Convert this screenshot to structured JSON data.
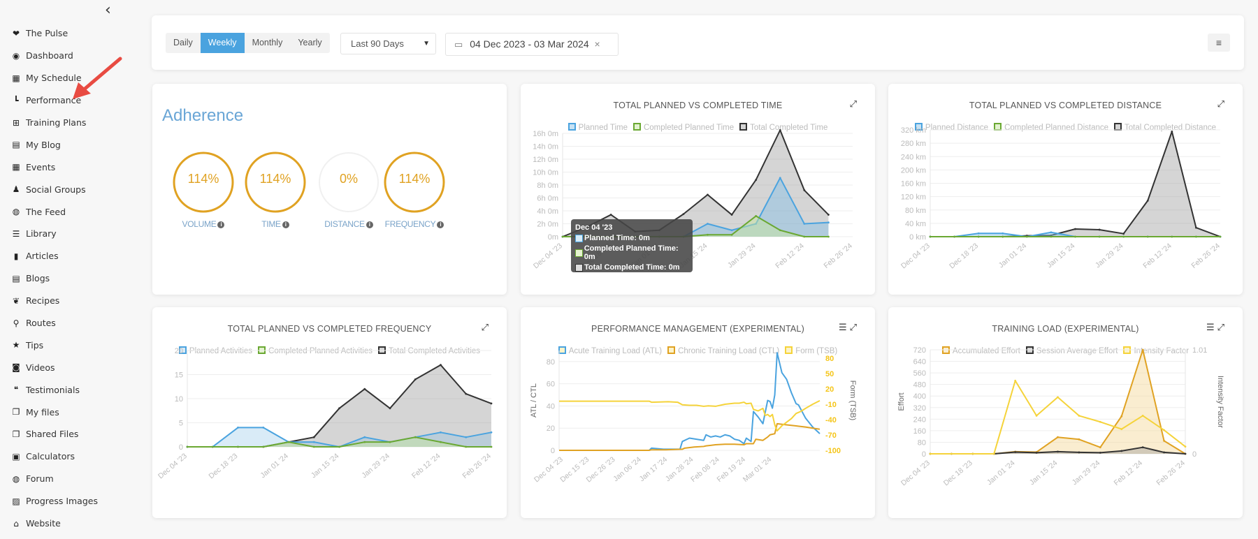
{
  "sidebar": {
    "collapse_icon": "chevron-left",
    "items": [
      {
        "label": "The Pulse",
        "icon": "heartbeat-icon",
        "glyph": "❤"
      },
      {
        "label": "Dashboard",
        "icon": "tachometer-icon",
        "glyph": "◉"
      },
      {
        "label": "My Schedule",
        "icon": "calendar-icon",
        "glyph": "▦"
      },
      {
        "label": "Performance",
        "icon": "bar-chart-icon",
        "glyph": "┗"
      },
      {
        "label": "Training Plans",
        "icon": "grid-icon",
        "glyph": "⊞"
      },
      {
        "label": "My Blog",
        "icon": "newspaper-icon",
        "glyph": "▤"
      },
      {
        "label": "Events",
        "icon": "calendar-icon",
        "glyph": "▦"
      },
      {
        "label": "Social Groups",
        "icon": "users-icon",
        "glyph": "♟"
      },
      {
        "label": "The Feed",
        "icon": "comments-icon",
        "glyph": "◍"
      },
      {
        "label": "Library",
        "icon": "list-icon",
        "glyph": "☰"
      },
      {
        "label": "Articles",
        "icon": "file-icon",
        "glyph": "▮"
      },
      {
        "label": "Blogs",
        "icon": "newspaper-icon",
        "glyph": "▤"
      },
      {
        "label": "Recipes",
        "icon": "leaf-icon",
        "glyph": "❦"
      },
      {
        "label": "Routes",
        "icon": "binoculars-icon",
        "glyph": "⚲"
      },
      {
        "label": "Tips",
        "icon": "star-icon",
        "glyph": "★"
      },
      {
        "label": "Videos",
        "icon": "camera-icon",
        "glyph": "◙"
      },
      {
        "label": "Testimonials",
        "icon": "quote-icon",
        "glyph": "❝"
      },
      {
        "label": "My files",
        "icon": "copy-icon",
        "glyph": "❐"
      },
      {
        "label": "Shared Files",
        "icon": "copy-icon",
        "glyph": "❐"
      },
      {
        "label": "Calculators",
        "icon": "calculator-icon",
        "glyph": "▣"
      },
      {
        "label": "Forum",
        "icon": "comments-icon",
        "glyph": "◍"
      },
      {
        "label": "Progress Images",
        "icon": "image-icon",
        "glyph": "▨"
      },
      {
        "label": "Website",
        "icon": "home-icon",
        "glyph": "⌂"
      }
    ]
  },
  "toolbar": {
    "periods": [
      "Daily",
      "Weekly",
      "Monthly",
      "Yearly"
    ],
    "active_period": "Weekly",
    "range_select": "Last 90 Days",
    "date_range": "04 Dec 2023 - 03 Mar 2024",
    "clear_icon": "×",
    "menu_icon": "≡"
  },
  "adherence": {
    "title": "Adherence",
    "gauges": [
      {
        "label": "VOLUME",
        "value": "114%",
        "percent": 114
      },
      {
        "label": "TIME",
        "value": "114%",
        "percent": 114
      },
      {
        "label": "DISTANCE",
        "value": "0%",
        "percent": 0
      },
      {
        "label": "FREQUENCY",
        "value": "114%",
        "percent": 114
      }
    ]
  },
  "colors": {
    "accent": "#4aa3df",
    "gauge": "#e0a222",
    "planned": "#4aa3df",
    "completed_planned": "#6aa832",
    "total": "#333333",
    "ctl": "#e0a222",
    "tsb": "#f5d33a"
  },
  "chart_data": [
    {
      "id": "time",
      "type": "area",
      "title": "TOTAL PLANNED VS COMPLETED TIME",
      "x": [
        "Dec 04 '23",
        "Dec 11 '23",
        "Dec 18 '23",
        "Dec 25 '23",
        "Jan 01 '24",
        "Jan 08 '24",
        "Jan 15 '24",
        "Jan 22 '24",
        "Jan 29 '24",
        "Feb 05 '24",
        "Feb 12 '24",
        "Feb 19 '24",
        "Feb 26 '24"
      ],
      "xticks": [
        "Dec 04 '23",
        "Dec 18 '23",
        "Jan 01 '24",
        "Jan 15 '24",
        "Jan 29 '24",
        "Feb 12 '24",
        "Feb 26 '24"
      ],
      "ylabel": "",
      "ylim": [
        0,
        16
      ],
      "yticks": [
        0,
        2,
        4,
        6,
        8,
        10,
        12,
        14,
        16
      ],
      "ytick_labels": [
        "0m",
        "2h 0m",
        "4h 0m",
        "6h 0m",
        "8h 0m",
        "10h 0m",
        "12h 0m",
        "14h 0m",
        "16h 0m"
      ],
      "series": [
        {
          "name": "Total Completed Time",
          "color": "#333333",
          "fill": "rgba(150,150,150,0.4)",
          "values": [
            0,
            1.5,
            3.4,
            0.8,
            1.0,
            3.5,
            6.5,
            3.4,
            8.8,
            16.5,
            7.2,
            3.4
          ]
        },
        {
          "name": "Planned Time",
          "color": "#4aa3df",
          "fill": "rgba(130,190,230,0.45)",
          "values": [
            0,
            0,
            0,
            0,
            0,
            0,
            2.0,
            1.0,
            2.0,
            9.1,
            2.0,
            2.2
          ]
        },
        {
          "name": "Completed Planned Time",
          "color": "#6aa832",
          "fill": "rgba(200,230,160,0.5)",
          "values": [
            0,
            0,
            0,
            0,
            0,
            0,
            0.3,
            0.3,
            3.2,
            1.0,
            0,
            0
          ]
        }
      ],
      "legend": [
        "Planned Time",
        "Completed Planned Time",
        "Total Completed Time"
      ],
      "tooltip": {
        "title": "Dec 04 '23",
        "rows": [
          "Planned Time: 0m",
          "Completed Planned Time: 0m",
          "Total Completed Time: 0m"
        ]
      }
    },
    {
      "id": "distance",
      "type": "area",
      "title": "TOTAL PLANNED VS COMPLETED DISTANCE",
      "x": [
        "Dec 04 '23",
        "Dec 11 '23",
        "Dec 18 '23",
        "Dec 25 '23",
        "Jan 01 '24",
        "Jan 08 '24",
        "Jan 15 '24",
        "Jan 22 '24",
        "Jan 29 '24",
        "Feb 05 '24",
        "Feb 12 '24",
        "Feb 19 '24",
        "Feb 26 '24"
      ],
      "xticks": [
        "Dec 04 '23",
        "Dec 18 '23",
        "Jan 01 '24",
        "Jan 15 '24",
        "Jan 29 '24",
        "Feb 12 '24",
        "Feb 26 '24"
      ],
      "ylim": [
        0,
        320
      ],
      "yticks": [
        0,
        40,
        80,
        120,
        160,
        200,
        240,
        280,
        320
      ],
      "ytick_labels": [
        "0 km",
        "40 km",
        "80 km",
        "120 km",
        "160 km",
        "200 km",
        "240 km",
        "280 km",
        "320 km"
      ],
      "series": [
        {
          "name": "Total Completed Distance",
          "color": "#333333",
          "fill": "rgba(150,150,150,0.4)",
          "values": [
            0,
            0,
            0,
            0,
            3,
            4,
            23,
            21,
            9,
            108,
            315,
            27,
            0
          ]
        },
        {
          "name": "Planned Distance",
          "color": "#4aa3df",
          "fill": "rgba(130,190,230,0.45)",
          "values": [
            0,
            0,
            10,
            10,
            0,
            13,
            0,
            0,
            0,
            0,
            0,
            0,
            0
          ]
        },
        {
          "name": "Completed Planned Distance",
          "color": "#6aa832",
          "fill": "rgba(200,230,160,0.5)",
          "values": [
            0,
            0,
            0,
            0,
            0,
            0,
            0,
            0,
            0,
            0,
            0,
            0,
            0
          ]
        }
      ],
      "legend": [
        "Planned Distance",
        "Completed Planned Distance",
        "Total Completed Distance"
      ]
    },
    {
      "id": "frequency",
      "type": "area",
      "title": "TOTAL PLANNED VS COMPLETED FREQUENCY",
      "x": [
        "Dec 04 '23",
        "Dec 11 '23",
        "Dec 18 '23",
        "Dec 25 '23",
        "Jan 01 '24",
        "Jan 08 '24",
        "Jan 15 '24",
        "Jan 22 '24",
        "Jan 29 '24",
        "Feb 05 '24",
        "Feb 12 '24",
        "Feb 19 '24",
        "Feb 26 '24"
      ],
      "xticks": [
        "Dec 04 '23",
        "Dec 18 '23",
        "Jan 01 '24",
        "Jan 15 '24",
        "Jan 29 '24",
        "Feb 12 '24",
        "Feb 26 '24"
      ],
      "ylim": [
        0,
        20
      ],
      "yticks": [
        0,
        5,
        10,
        15,
        20
      ],
      "ytick_labels": [
        "0",
        "5",
        "10",
        "15",
        "20"
      ],
      "series": [
        {
          "name": "Total Completed Activities",
          "color": "#333333",
          "fill": "rgba(150,150,150,0.4)",
          "values": [
            0,
            0,
            0,
            0,
            1,
            2,
            8,
            12,
            8,
            14,
            17,
            11,
            9
          ]
        },
        {
          "name": "Planned Activities",
          "color": "#4aa3df",
          "fill": "rgba(130,190,230,0.3)",
          "values": [
            0,
            0,
            4,
            4,
            1,
            1,
            0,
            2,
            1,
            2,
            3,
            2,
            3
          ]
        },
        {
          "name": "Completed Planned Activities",
          "color": "#6aa832",
          "fill": "rgba(200,230,160,0.5)",
          "values": [
            0,
            0,
            0,
            0,
            1,
            0,
            0,
            1,
            1,
            2,
            1,
            0,
            0
          ]
        }
      ],
      "legend": [
        "Planned Activities",
        "Completed Planned Activities",
        "Total Completed Activities"
      ]
    },
    {
      "id": "pmc",
      "type": "line",
      "title": "PERFORMANCE MANAGEMENT (EXPERIMENTAL)",
      "xticks": [
        "Dec 04 '23",
        "Dec 15 '23",
        "Dec 26 '23",
        "Jan 06 '24",
        "Jan 17 '24",
        "Jan 28 '24",
        "Feb 08 '24",
        "Feb 19 '24",
        "Mar 01 '24"
      ],
      "x_days": 91,
      "ylabel": "ATL / CTL",
      "y2label": "Form (TSB)",
      "ylim": [
        0,
        90
      ],
      "yticks": [
        0,
        20,
        40,
        60,
        80
      ],
      "y2lim": [
        -100,
        95
      ],
      "y2ticks": [
        -100,
        -70,
        -40,
        -10,
        20,
        50,
        80
      ],
      "series": [
        {
          "name": "Acute Training Load (ATL)",
          "color": "#4aa3df",
          "axis": "left",
          "points": [
            [
              0,
              0
            ],
            [
              38,
              0
            ],
            [
              39,
              2
            ],
            [
              44,
              1
            ],
            [
              51,
              1
            ],
            [
              52,
              8
            ],
            [
              55,
              11
            ],
            [
              58,
              10
            ],
            [
              61,
              9
            ],
            [
              62,
              14
            ],
            [
              64,
              12
            ],
            [
              66,
              13
            ],
            [
              68,
              12
            ],
            [
              70,
              14
            ],
            [
              72,
              13
            ],
            [
              74,
              10
            ],
            [
              76,
              9
            ],
            [
              78,
              6
            ],
            [
              79,
              11
            ],
            [
              81,
              8
            ],
            [
              82,
              35
            ],
            [
              84,
              30
            ],
            [
              86,
              24
            ],
            [
              88,
              45
            ],
            [
              89,
              44
            ],
            [
              90,
              38
            ],
            [
              91,
              50
            ],
            [
              92,
              88
            ],
            [
              94,
              70
            ],
            [
              96,
              64
            ],
            [
              98,
              52
            ],
            [
              100,
              42
            ],
            [
              101,
              41
            ],
            [
              104,
              29
            ],
            [
              107,
              21
            ],
            [
              110,
              15
            ]
          ]
        },
        {
          "name": "Chronic Training Load (CTL)",
          "color": "#e0a222",
          "axis": "left",
          "points": [
            [
              0,
              0
            ],
            [
              38,
              0
            ],
            [
              39,
              0.5
            ],
            [
              45,
              0.5
            ],
            [
              52,
              1
            ],
            [
              53,
              2
            ],
            [
              57,
              3
            ],
            [
              61,
              3.5
            ],
            [
              62,
              4
            ],
            [
              66,
              5
            ],
            [
              70,
              5.5
            ],
            [
              74,
              5.5
            ],
            [
              78,
              5
            ],
            [
              79,
              6
            ],
            [
              82,
              6
            ],
            [
              83,
              10
            ],
            [
              86,
              9
            ],
            [
              88,
              12
            ],
            [
              89,
              14
            ],
            [
              91,
              15
            ],
            [
              92,
              24
            ],
            [
              96,
              23
            ],
            [
              100,
              22
            ],
            [
              104,
              21
            ],
            [
              107,
              20
            ],
            [
              110,
              19
            ]
          ]
        },
        {
          "name": "Form (TSB)",
          "color": "#f5d33a",
          "axis": "right",
          "points": [
            [
              0,
              -4
            ],
            [
              38,
              -4
            ],
            [
              39,
              -6
            ],
            [
              46,
              -5
            ],
            [
              50,
              -6
            ],
            [
              52,
              -11
            ],
            [
              55,
              -12
            ],
            [
              58,
              -12
            ],
            [
              61,
              -14
            ],
            [
              63,
              -13
            ],
            [
              66,
              -14
            ],
            [
              70,
              -10
            ],
            [
              74,
              -8
            ],
            [
              76,
              -8
            ],
            [
              78,
              -6
            ],
            [
              79,
              -9
            ],
            [
              81,
              -8
            ],
            [
              82,
              -20
            ],
            [
              84,
              -23
            ],
            [
              86,
              -18
            ],
            [
              87,
              -32
            ],
            [
              88,
              -30
            ],
            [
              89,
              -34
            ],
            [
              90,
              -30
            ],
            [
              91,
              -50
            ],
            [
              92,
              -62
            ],
            [
              94,
              -52
            ],
            [
              96,
              -45
            ],
            [
              98,
              -38
            ],
            [
              100,
              -28
            ],
            [
              102,
              -24
            ],
            [
              104,
              -18
            ],
            [
              107,
              -10
            ],
            [
              110,
              -3
            ]
          ]
        }
      ],
      "legend": [
        "Acute Training Load (ATL)",
        "Chronic Training Load (CTL)",
        "Form (TSB)"
      ]
    },
    {
      "id": "training_load",
      "type": "area",
      "title": "TRAINING LOAD (EXPERIMENTAL)",
      "x": [
        "Dec 04 '23",
        "Dec 11 '23",
        "Dec 18 '23",
        "Dec 25 '23",
        "Jan 01 '24",
        "Jan 08 '24",
        "Jan 15 '24",
        "Jan 22 '24",
        "Jan 29 '24",
        "Feb 05 '24",
        "Feb 12 '24",
        "Feb 19 '24",
        "Feb 26 '24"
      ],
      "xticks": [
        "Dec 04 '23",
        "Dec 18 '23",
        "Jan 01 '24",
        "Jan 15 '24",
        "Jan 29 '24",
        "Feb 12 '24",
        "Feb 26 '24"
      ],
      "ylabel": "Effort",
      "y2label": "Intensity Factor",
      "ylim": [
        0,
        720
      ],
      "yticks": [
        0,
        80,
        160,
        240,
        320,
        400,
        480,
        560,
        640,
        720
      ],
      "y2lim": [
        0,
        1.01
      ],
      "y2ticks": [
        0,
        1.01
      ],
      "series": [
        {
          "name": "Accumulated Effort",
          "color": "#e0a222",
          "fill": "rgba(245,215,150,0.45)",
          "axis": "left",
          "values": [
            0,
            0,
            0,
            0,
            15,
            12,
            115,
            100,
            45,
            260,
            720,
            90,
            0
          ]
        },
        {
          "name": "Session Average Effort",
          "color": "#333333",
          "fill": "rgba(150,150,150,0.4)",
          "axis": "left",
          "values": [
            0,
            0,
            0,
            0,
            12,
            8,
            15,
            10,
            8,
            20,
            45,
            10,
            0
          ]
        },
        {
          "name": "Intensity Factor",
          "color": "#f5d33a",
          "fill": "none",
          "axis": "right",
          "values": [
            0,
            0,
            0,
            0,
            0.71,
            0.37,
            0.55,
            0.37,
            0.31,
            0.24,
            0.37,
            0.23,
            0.07
          ]
        }
      ],
      "legend": [
        "Accumulated Effort",
        "Session Average Effort",
        "Intensity Factor"
      ]
    }
  ]
}
